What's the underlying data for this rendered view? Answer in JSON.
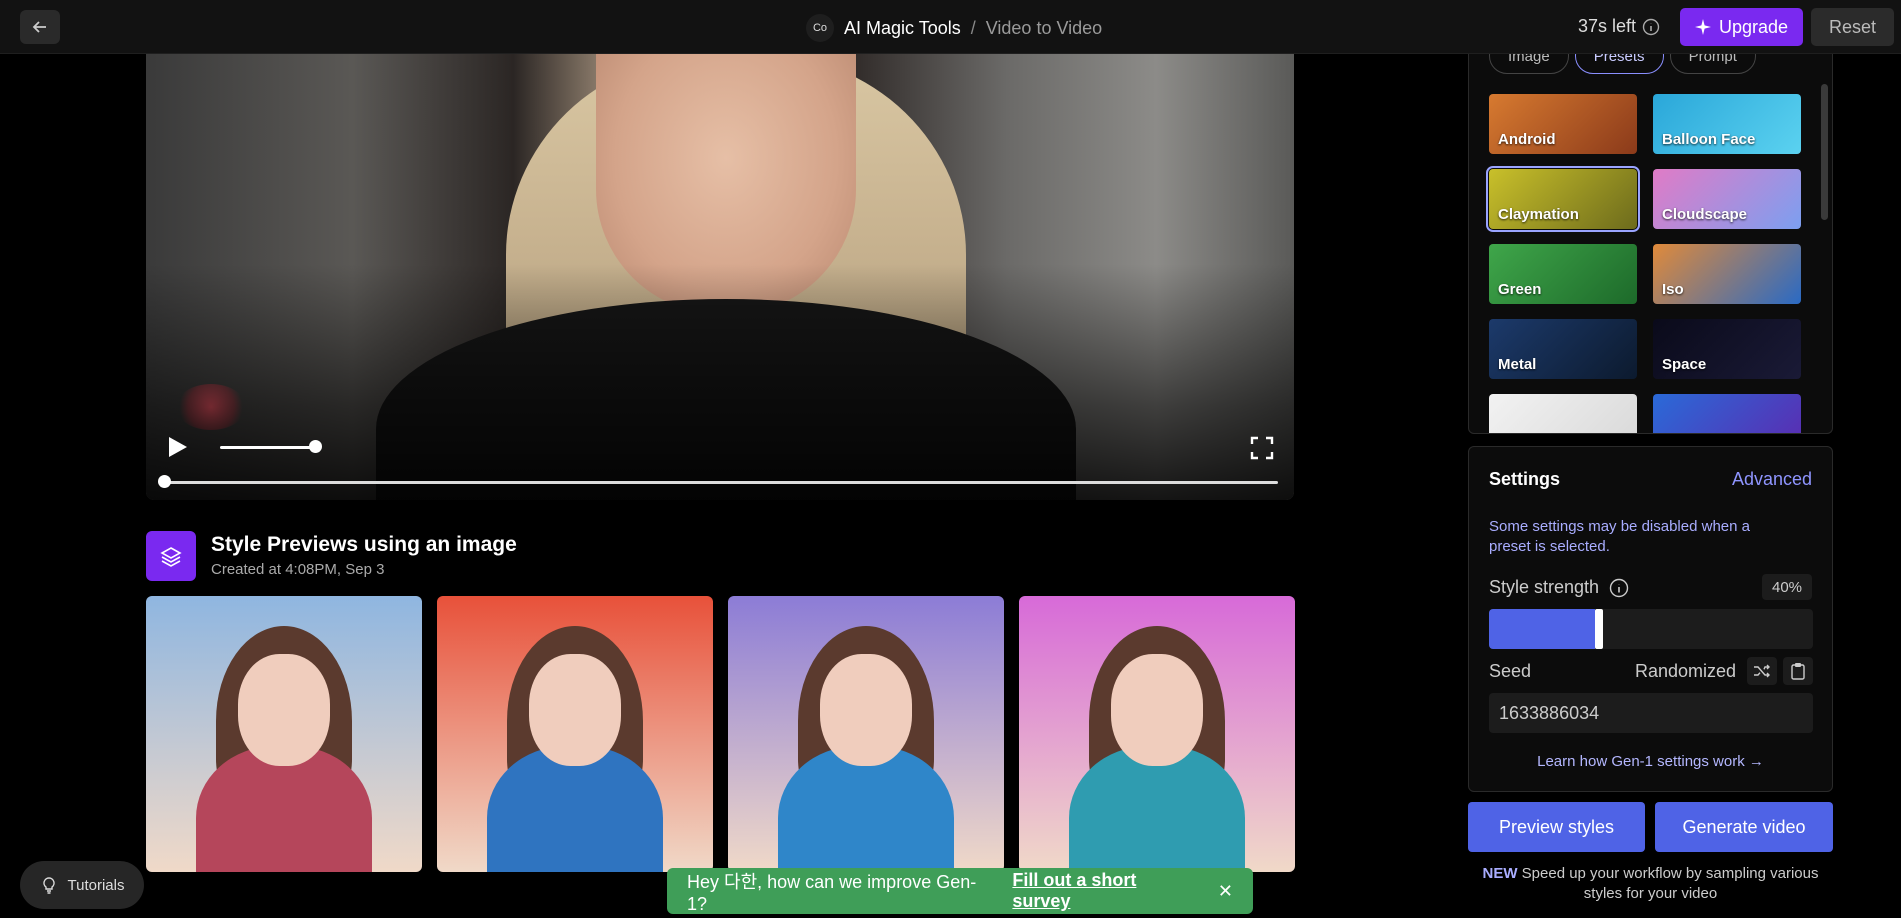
{
  "header": {
    "logo_text": "Co",
    "app_title": "AI Magic Tools",
    "separator": "/",
    "page_title": "Video to Video",
    "time_left": "37s left",
    "upgrade_label": "Upgrade",
    "reset_label": "Reset"
  },
  "video": {
    "progress": 0,
    "volume": 0.85
  },
  "previews": {
    "title": "Style Previews using an image",
    "subtitle": "Created at 4:08PM, Sep 3",
    "items": [
      {
        "bg": "#8fb6e0",
        "body": "#b5465b"
      },
      {
        "bg": "#e8513a",
        "body": "#2f74c0"
      },
      {
        "bg": "#8c7cd6",
        "body": "#2f86c9"
      },
      {
        "bg": "#d76ad8",
        "body": "#2f9cb0"
      }
    ]
  },
  "presets": {
    "tabs": [
      {
        "label": "Image",
        "active": false
      },
      {
        "label": "Presets",
        "active": true
      },
      {
        "label": "Prompt",
        "active": false
      }
    ],
    "items": [
      {
        "label": "Android",
        "colors": [
          "#d77a30",
          "#8b3a1a"
        ]
      },
      {
        "label": "Balloon Face",
        "colors": [
          "#2aa7d9",
          "#5bd2f0"
        ]
      },
      {
        "label": "Claymation",
        "colors": [
          "#c9c02a",
          "#6d6b1c"
        ]
      },
      {
        "label": "Cloudscape",
        "colors": [
          "#e07bc6",
          "#7c9ff0"
        ]
      },
      {
        "label": "Green",
        "colors": [
          "#3fa64a",
          "#1d6a2a"
        ]
      },
      {
        "label": "Iso",
        "colors": [
          "#e08a3a",
          "#2a6ac4"
        ]
      },
      {
        "label": "Metal",
        "colors": [
          "#1c3a6b",
          "#0c1a2e"
        ]
      },
      {
        "label": "Space",
        "colors": [
          "#0a0a1a",
          "#1a1a36"
        ]
      },
      {
        "label": "",
        "colors": [
          "#f2f2f2",
          "#d8d8d8"
        ]
      },
      {
        "label": "",
        "colors": [
          "#2a6ad8",
          "#5c2ab0"
        ]
      }
    ],
    "selected_index": 2
  },
  "settings": {
    "title": "Settings",
    "advanced_label": "Advanced",
    "note": "Some settings may be disabled when a preset is selected.",
    "style_strength_label": "Style strength",
    "style_strength_value": "40%",
    "style_strength": 0.4,
    "seed_label": "Seed",
    "randomized_label": "Randomized",
    "seed_value": "1633886034",
    "learn_link": "Learn how Gen-1 settings work"
  },
  "actions": {
    "preview_label": "Preview styles",
    "generate_label": "Generate video",
    "new_badge": "NEW",
    "new_note": " Speed up your workflow by sampling various styles for your video"
  },
  "tutorials_label": "Tutorials",
  "survey": {
    "text": "Hey 다한, how can we improve Gen-1?",
    "link": "Fill out a short survey",
    "close": "✕"
  },
  "colors": {
    "accent_purple": "#7a29f0",
    "accent_blue": "#4f63e6",
    "survey_green": "#3f9e58"
  }
}
